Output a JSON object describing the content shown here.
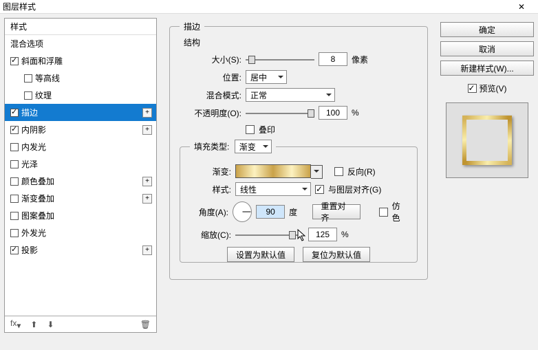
{
  "titlebar": {
    "title": "图层样式"
  },
  "left": {
    "header": "样式",
    "blend_options": "混合选项",
    "items": [
      {
        "key": "bevel",
        "label": "斜面和浮雕",
        "checked": true,
        "plus": false,
        "indent": false
      },
      {
        "key": "contour",
        "label": "等高线",
        "checked": false,
        "plus": false,
        "indent": true
      },
      {
        "key": "texture",
        "label": "纹理",
        "checked": false,
        "plus": false,
        "indent": true
      },
      {
        "key": "stroke",
        "label": "描边",
        "checked": true,
        "plus": true,
        "indent": false,
        "selected": true
      },
      {
        "key": "inner-shadow",
        "label": "内阴影",
        "checked": true,
        "plus": true,
        "indent": false
      },
      {
        "key": "inner-glow",
        "label": "内发光",
        "checked": false,
        "plus": false,
        "indent": false
      },
      {
        "key": "satin",
        "label": "光泽",
        "checked": false,
        "plus": false,
        "indent": false
      },
      {
        "key": "color-overlay",
        "label": "颜色叠加",
        "checked": false,
        "plus": true,
        "indent": false
      },
      {
        "key": "grad-overlay",
        "label": "渐变叠加",
        "checked": false,
        "plus": true,
        "indent": false
      },
      {
        "key": "pat-overlay",
        "label": "图案叠加",
        "checked": false,
        "plus": false,
        "indent": false
      },
      {
        "key": "outer-glow",
        "label": "外发光",
        "checked": false,
        "plus": false,
        "indent": false
      },
      {
        "key": "drop-shadow",
        "label": "投影",
        "checked": true,
        "plus": true,
        "indent": false
      }
    ]
  },
  "center": {
    "fieldset1_title": "描边",
    "structure_title": "结构",
    "size_label": "大小(S):",
    "size_value": "8",
    "px": "像素",
    "position_label": "位置:",
    "position_value": "居中",
    "blend_label": "混合模式:",
    "blend_value": "正常",
    "opacity_label": "不透明度(O):",
    "opacity_value": "100",
    "pct": "%",
    "overprint_label": "叠印",
    "fill_type_label": "填充类型:",
    "fill_type_value": "渐变",
    "gradient_label": "渐变:",
    "reverse_label": "反向(R)",
    "style_label": "样式:",
    "style_value": "线性",
    "align_label": "与图层对齐(G)",
    "angle_label": "角度(A):",
    "angle_value": "90",
    "deg": "度",
    "reset_align": "重置对齐",
    "dither_label": "仿色",
    "scale_label": "缩放(C):",
    "scale_value": "125",
    "set_default": "设置为默认值",
    "reset_default": "复位为默认值"
  },
  "right": {
    "ok": "确定",
    "cancel": "取消",
    "new_style": "新建样式(W)...",
    "preview": "预览(V)"
  }
}
